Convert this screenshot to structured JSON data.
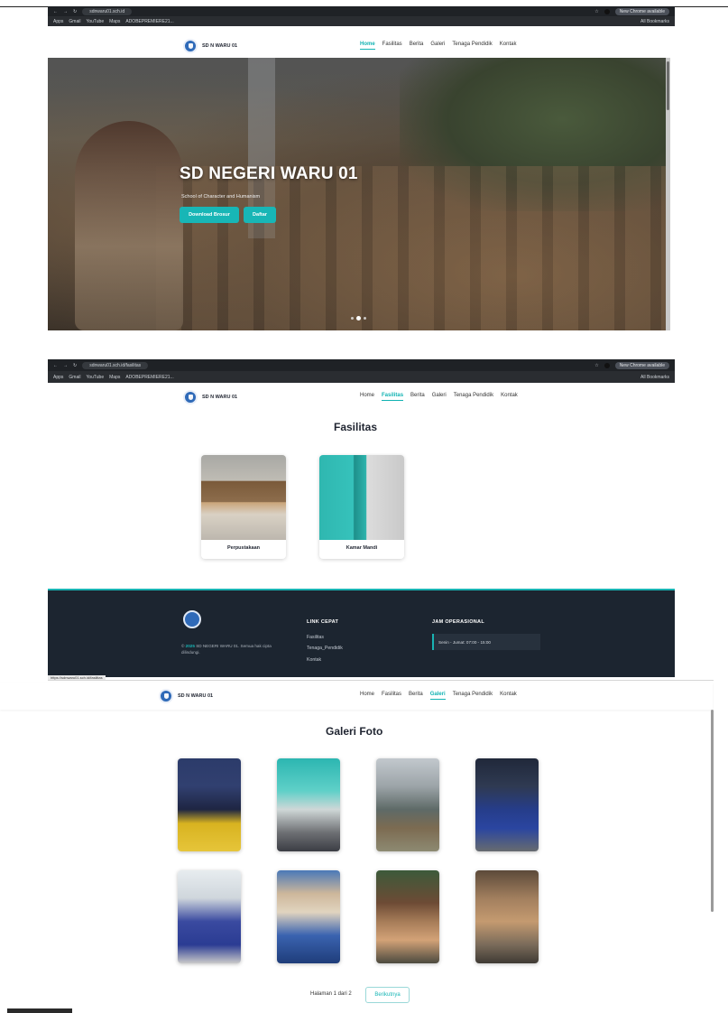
{
  "browser": {
    "tab1_url": "sdnwaru01.sch.id",
    "tab2_url": "sdnwaru01.sch.id/fasilitas",
    "bookmarks": [
      "Apps",
      "Gmail",
      "YouTube",
      "Maps",
      "ADOBEPREMIERE21..."
    ],
    "update_label": "New Chrome available",
    "all_bookmarks": "All Bookmarks"
  },
  "site": {
    "brand": "SD N WARU 01",
    "menu": [
      "Home",
      "Fasilitas",
      "Berita",
      "Galeri",
      "Tenaga Pendidik",
      "Kontak"
    ]
  },
  "hero": {
    "title": "SD NEGERI WARU 01",
    "tagline": "School of Character and Humanism",
    "btn_download": "Download Brosur",
    "btn_daftar": "Daftar"
  },
  "fasilitas": {
    "title": "Fasilitas",
    "items": [
      {
        "label": "Perpustakaan"
      },
      {
        "label": "Kamar Mandi"
      }
    ]
  },
  "footer": {
    "copyright_year": "2025",
    "copyright_text": "SD NEGERI WARU 01. Semua hak cipta dilindungi.",
    "link_heading": "LINK CEPAT",
    "links": [
      "Fasilitas",
      "Tenaga_Pendidik",
      "Kontak"
    ],
    "hours_heading": "JAM OPERASIONAL",
    "hours": "Senin - Jumat: 07:00 - 15:00",
    "status_url": "https://sdnwaru01.sch.id/fasilitas"
  },
  "galeri": {
    "title": "Galeri Foto",
    "pagination": "Halaman 1 dari 2",
    "next": "Berikutnya"
  }
}
